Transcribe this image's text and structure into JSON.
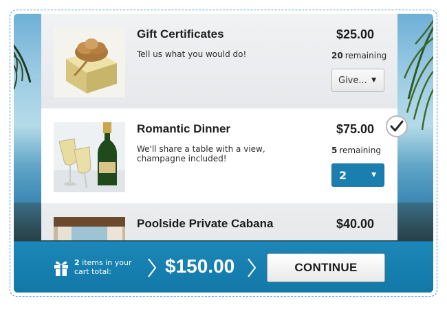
{
  "items": [
    {
      "title": "Gift Certificates",
      "description": "Tell us what you would do!",
      "price": "$25.00",
      "remaining_count": "20",
      "remaining_label": "remaining",
      "quantity": "Give...",
      "image_icon": "gift-box-image",
      "selected": false
    },
    {
      "title": "Romantic Dinner",
      "description": "We'll share a table with a view, champagne included!",
      "price": "$75.00",
      "remaining_count": "5",
      "remaining_label": "remaining",
      "quantity": "2",
      "image_icon": "champagne-image",
      "selected": true
    },
    {
      "title": "Poolside Private Cabana",
      "price": "$40.00",
      "image_icon": "cabana-image"
    }
  ],
  "footer": {
    "cart_count": "2",
    "cart_label_line1": "items in your",
    "cart_label_line2": "cart total:",
    "total": "$150.00",
    "continue_label": "CONTINUE",
    "cart_icon": "gift-icon"
  },
  "colors": {
    "accent": "#1a7fae",
    "footer_bg": "#1b84b5",
    "selected_row": "#ffffff"
  }
}
